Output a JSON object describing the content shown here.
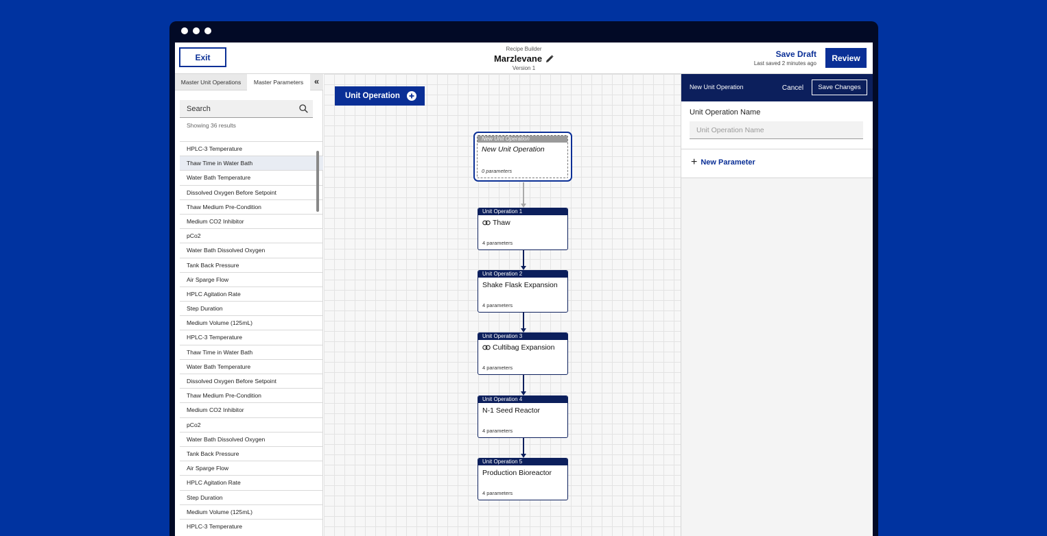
{
  "header": {
    "exit_label": "Exit",
    "kicker": "Recipe Builder",
    "recipe_name": "Marzlevane",
    "version": "Version 1",
    "save_draft_label": "Save Draft",
    "last_saved": "Last saved 2 minutes ago",
    "review_label": "Review"
  },
  "left_panel": {
    "tabs": [
      "Master Unit Operations",
      "Master Parameters"
    ],
    "active_tab": "Master Parameters",
    "collapse_glyph": "«",
    "search_placeholder": "Search",
    "result_count": "Showing 36 results",
    "selected_index": 1,
    "items": [
      "HPLC-3 Temperature",
      "Thaw Time in Water Bath",
      "Water Bath Temperature",
      "Dissolved Oxygen Before Setpoint",
      "Thaw Medium Pre-Condition",
      "Medium CO2 Inhibitor",
      "pCo2",
      "Water Bath Dissolved Oxygen",
      "Tank Back Pressure",
      "Air Sparge Flow",
      "HPLC Agitation Rate",
      "Step Duration",
      "Medium Volume (125mL)",
      "HPLC-3 Temperature",
      "Thaw Time in Water Bath",
      "Water Bath Temperature",
      "Dissolved Oxygen Before Setpoint",
      "Thaw Medium Pre-Condition",
      "Medium CO2 Inhibitor",
      "pCo2",
      "Water Bath Dissolved Oxygen",
      "Tank Back Pressure",
      "Air Sparge Flow",
      "HPLC Agitation Rate",
      "Step Duration",
      "Medium Volume (125mL)",
      "HPLC-3 Temperature"
    ]
  },
  "canvas": {
    "add_button_label": "Unit Operation",
    "new_node": {
      "header": "New Unit Operation",
      "name": "New Unit Operation",
      "params": "0 parameters"
    },
    "nodes": [
      {
        "header": "Unit Operation 1",
        "name": "Thaw",
        "params": "4 parameters",
        "linked": true
      },
      {
        "header": "Unit Operation 2",
        "name": "Shake Flask Expansion",
        "params": "4 parameters",
        "linked": false
      },
      {
        "header": "Unit Operation 3",
        "name": "Cultibag Expansion",
        "params": "4 parameters",
        "linked": true
      },
      {
        "header": "Unit Operation 4",
        "name": "N-1 Seed Reactor",
        "params": "4 parameters",
        "linked": false
      },
      {
        "header": "Unit Operation 5",
        "name": "Production Bioreactor",
        "params": "4 parameters",
        "linked": false
      }
    ]
  },
  "right_panel": {
    "title": "New Unit Operation",
    "cancel_label": "Cancel",
    "save_label": "Save Changes",
    "field_label": "Unit Operation Name",
    "field_placeholder": "Unit Operation Name",
    "field_value": "",
    "new_param_label": "New Parameter"
  },
  "colors": {
    "background": "#0033a0",
    "primary": "#0a2f96",
    "node_header": "#0c1f5c",
    "window_chrome": "#020a26"
  }
}
